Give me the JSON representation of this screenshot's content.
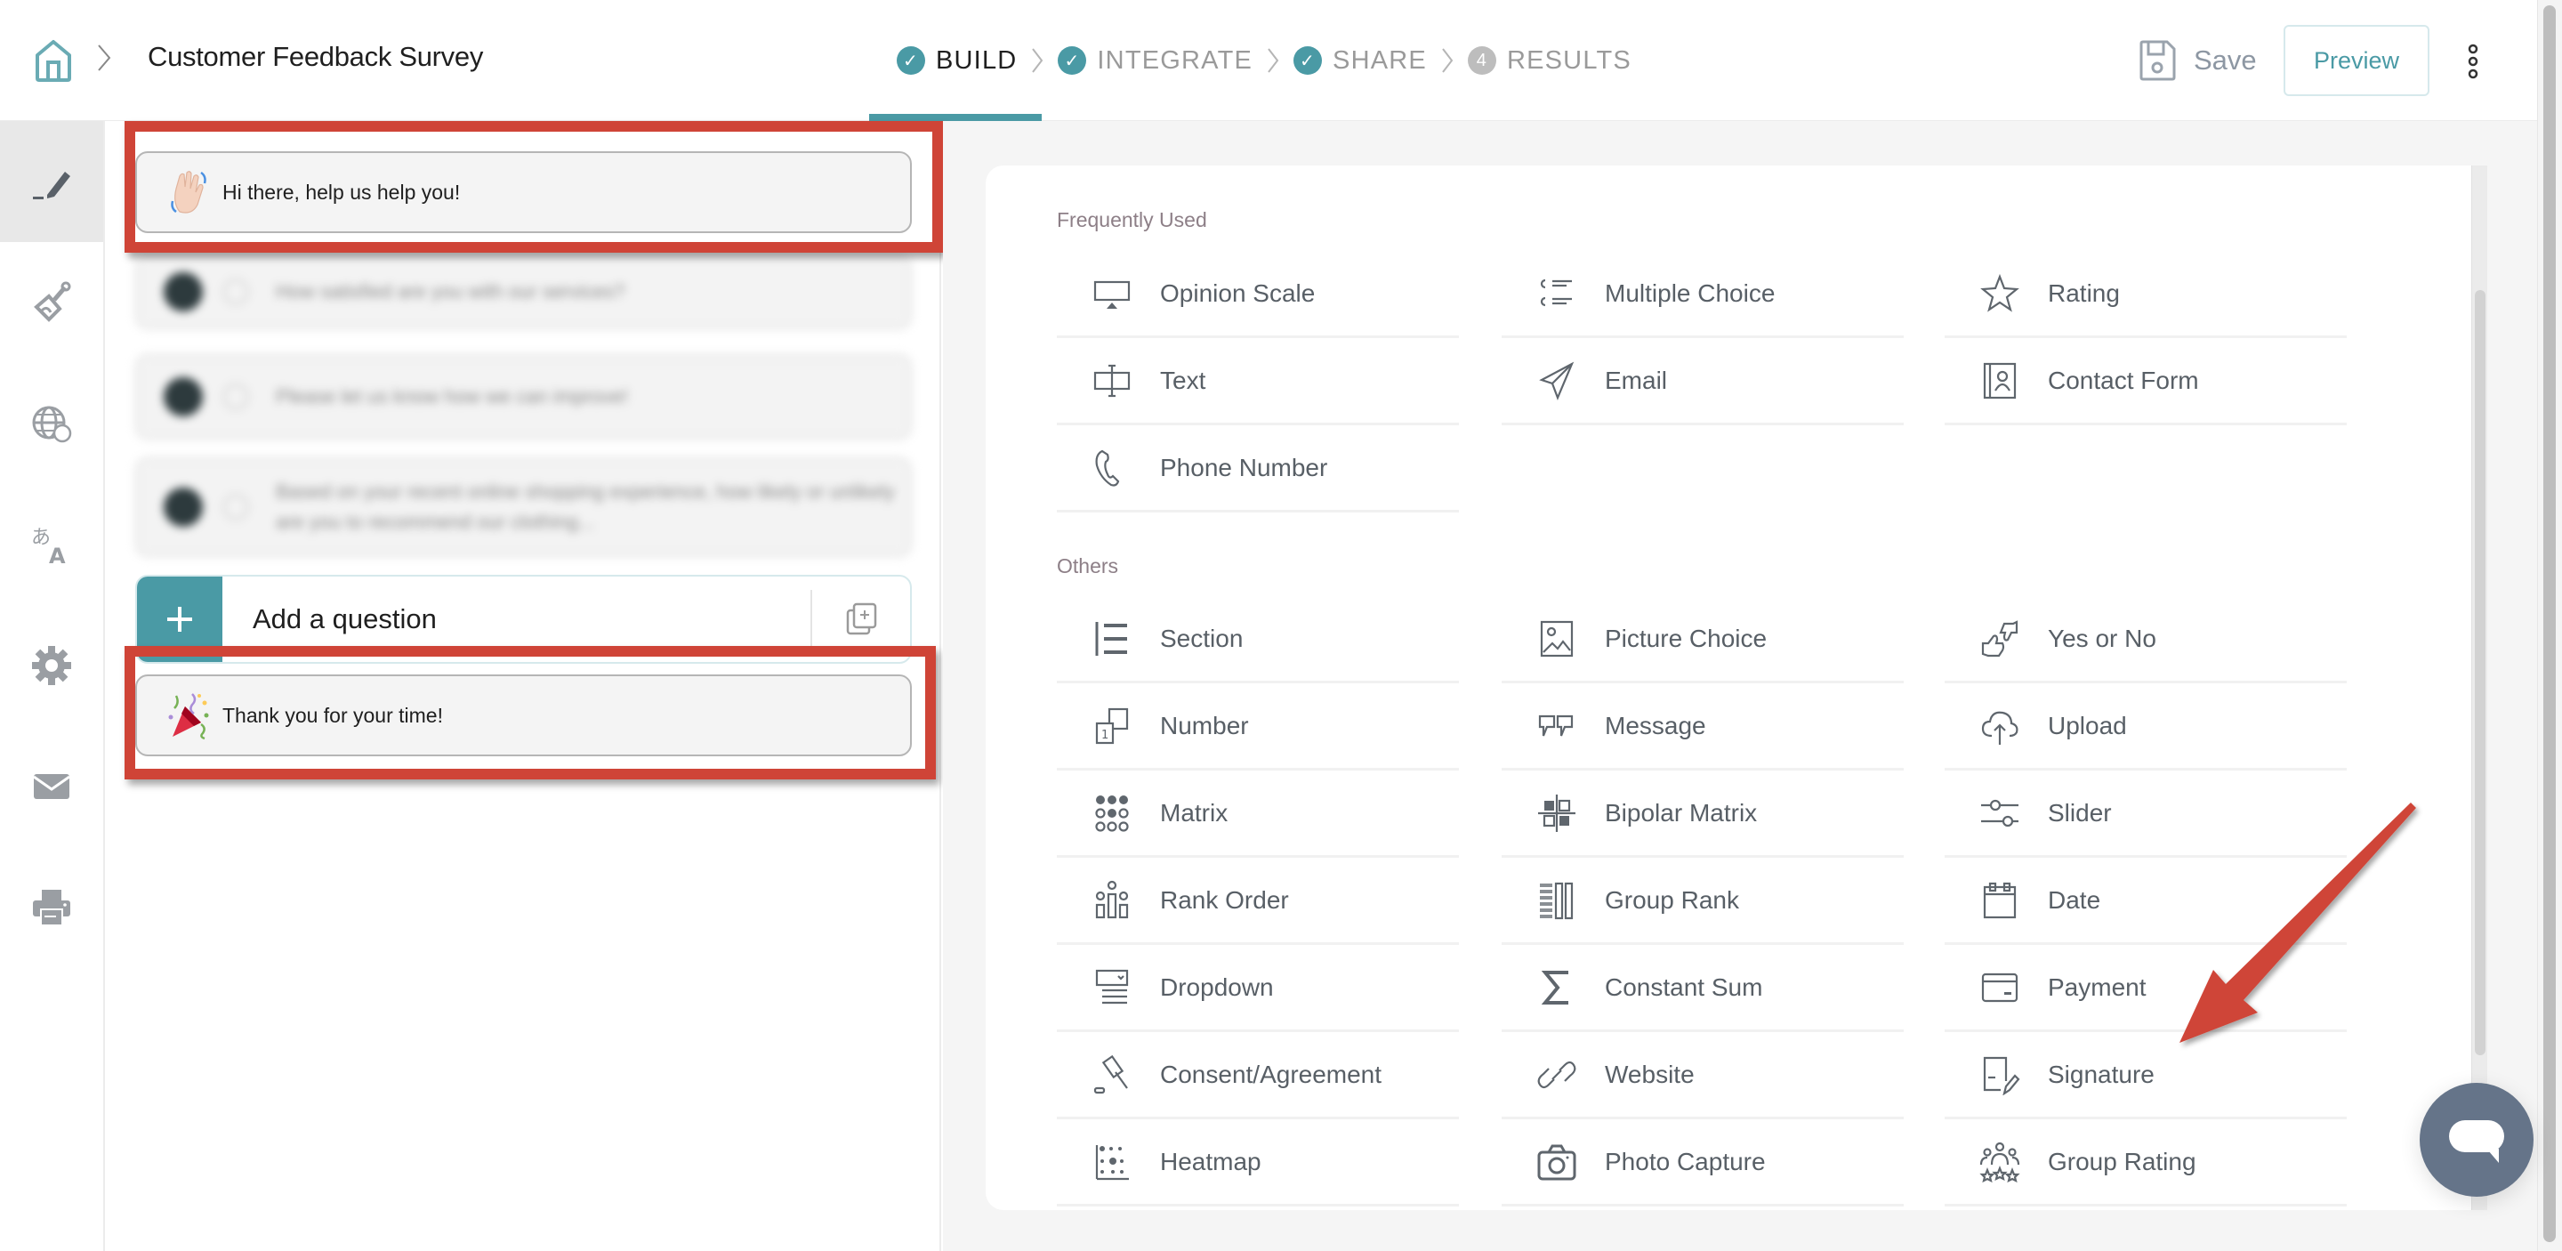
{
  "header": {
    "home_icon": "home-icon",
    "title": "Customer Feedback Survey",
    "steps": [
      {
        "label": "BUILD",
        "badge": "✓",
        "state": "active"
      },
      {
        "label": "INTEGRATE",
        "badge": "✓",
        "state": "done"
      },
      {
        "label": "SHARE",
        "badge": "✓",
        "state": "done"
      },
      {
        "label": "RESULTS",
        "badge": "4",
        "state": "pending"
      }
    ],
    "save_label": "Save",
    "preview_label": "Preview"
  },
  "rail": {
    "items": [
      {
        "name": "build",
        "icon": "pen-icon",
        "active": true
      },
      {
        "name": "theme",
        "icon": "paint-brush-icon",
        "active": false
      },
      {
        "name": "languages",
        "icon": "globe-icon",
        "active": false
      },
      {
        "name": "translate",
        "icon": "translate-icon",
        "active": false
      },
      {
        "name": "settings",
        "icon": "gear-icon",
        "active": false
      },
      {
        "name": "email",
        "icon": "envelope-icon",
        "active": false
      },
      {
        "name": "print",
        "icon": "printer-icon",
        "active": false
      }
    ]
  },
  "builder": {
    "welcome": {
      "emoji": "waving-hand",
      "text": "Hi there, help us help you!"
    },
    "questions": [
      {
        "text": "How satisfied are you with our services?"
      },
      {
        "text": "Please let us know how we can improve!"
      },
      {
        "text": "Based on your recent online shopping experience, how likely or unlikely are you to recommend our clothing..."
      }
    ],
    "add_question_label": "Add a question",
    "thank_you": {
      "emoji": "party-popper",
      "text": "Thank you for your time!"
    }
  },
  "question_types": {
    "frequently_used_label": "Frequently Used",
    "frequently_used": [
      {
        "label": "Opinion Scale",
        "icon": "opinion-scale-icon"
      },
      {
        "label": "Multiple Choice",
        "icon": "multiple-choice-icon"
      },
      {
        "label": "Rating",
        "icon": "star-icon"
      },
      {
        "label": "Text",
        "icon": "text-cursor-icon"
      },
      {
        "label": "Email",
        "icon": "paper-plane-icon"
      },
      {
        "label": "Contact Form",
        "icon": "contact-card-icon"
      },
      {
        "label": "Phone Number",
        "icon": "phone-icon"
      }
    ],
    "others_label": "Others",
    "others": [
      {
        "label": "Section",
        "icon": "section-icon"
      },
      {
        "label": "Picture Choice",
        "icon": "picture-icon"
      },
      {
        "label": "Yes or No",
        "icon": "thumbs-up-down-icon"
      },
      {
        "label": "Number",
        "icon": "number-icon"
      },
      {
        "label": "Message",
        "icon": "quote-icon"
      },
      {
        "label": "Upload",
        "icon": "cloud-upload-icon"
      },
      {
        "label": "Matrix",
        "icon": "matrix-icon"
      },
      {
        "label": "Bipolar Matrix",
        "icon": "bipolar-matrix-icon"
      },
      {
        "label": "Slider",
        "icon": "slider-icon"
      },
      {
        "label": "Rank Order",
        "icon": "rank-order-icon"
      },
      {
        "label": "Group Rank",
        "icon": "group-rank-icon"
      },
      {
        "label": "Date",
        "icon": "calendar-icon"
      },
      {
        "label": "Dropdown",
        "icon": "dropdown-icon"
      },
      {
        "label": "Constant Sum",
        "icon": "sigma-icon"
      },
      {
        "label": "Payment",
        "icon": "credit-card-icon"
      },
      {
        "label": "Consent/Agreement",
        "icon": "gavel-icon"
      },
      {
        "label": "Website",
        "icon": "link-icon"
      },
      {
        "label": "Signature",
        "icon": "signature-icon"
      },
      {
        "label": "Heatmap",
        "icon": "heatmap-icon"
      },
      {
        "label": "Photo Capture",
        "icon": "camera-icon"
      },
      {
        "label": "Group Rating",
        "icon": "group-rating-icon"
      }
    ]
  },
  "colors": {
    "accent": "#4a9aa5",
    "annotation": "#cf4437",
    "chat": "#657489"
  }
}
